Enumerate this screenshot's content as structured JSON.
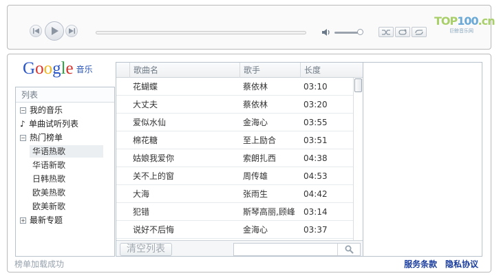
{
  "player": {
    "icons": {
      "prev": "skip-previous-icon",
      "play": "play-icon",
      "next": "skip-next-icon",
      "volume": "speaker-volume-icon",
      "mode_shuffle": "shuffle-icon",
      "mode_repeat": "repeat-icon",
      "mode_loop": "loop-icon"
    },
    "volume_level": 0.85,
    "progress": 0,
    "brand_logo": {
      "main": "TOP",
      "accent": "100",
      "tail": ".cn",
      "sub": "巨鲸音乐网"
    }
  },
  "google_logo": {
    "letters": [
      "G",
      "o",
      "o",
      "g",
      "l",
      "e"
    ],
    "colors": [
      "#2a56c6",
      "#d8312b",
      "#f2b51a",
      "#2a56c6",
      "#2f9e44",
      "#d8312b"
    ],
    "suffix": "音乐"
  },
  "nav": {
    "header": "列表",
    "items": [
      {
        "label": "我的音乐",
        "type": "expander",
        "sign": "−"
      },
      {
        "label": "单曲试听列表",
        "type": "note"
      },
      {
        "label": "热门榜单",
        "type": "expander",
        "sign": "−"
      },
      {
        "label": "华语热歌",
        "type": "sub",
        "selected": true
      },
      {
        "label": "华语新歌",
        "type": "sub"
      },
      {
        "label": "日韩热歌",
        "type": "sub"
      },
      {
        "label": "欧美热歌",
        "type": "sub"
      },
      {
        "label": "欧美新歌",
        "type": "sub"
      },
      {
        "label": "最新专题",
        "type": "expander",
        "sign": "+"
      }
    ]
  },
  "songs": {
    "columns": [
      "歌曲名",
      "歌手",
      "长度"
    ],
    "rows": [
      {
        "title": "花蝴蝶",
        "artist": "蔡依林",
        "length": "03:10"
      },
      {
        "title": "大丈夫",
        "artist": "蔡依林",
        "length": "03:20"
      },
      {
        "title": "爱似水仙",
        "artist": "金海心",
        "length": "03:55"
      },
      {
        "title": "棉花糖",
        "artist": "至上励合",
        "length": "03:51"
      },
      {
        "title": "姑娘我爱你",
        "artist": "索朗扎西",
        "length": "04:38"
      },
      {
        "title": "关不上的窗",
        "artist": "周传雄",
        "length": "04:53"
      },
      {
        "title": "大海",
        "artist": "张雨生",
        "length": "04:42"
      },
      {
        "title": "犯错",
        "artist": "斯琴高丽,顾峰",
        "length": "03:14"
      },
      {
        "title": "说好不后悔",
        "artist": "金海心",
        "length": "03:37"
      }
    ],
    "clear_label": "清空列表",
    "search_placeholder": "",
    "search_icon": "magnifier-icon"
  },
  "footer": {
    "status": "榜单加载成功",
    "terms": "服务条款",
    "privacy": "隐私协议"
  }
}
